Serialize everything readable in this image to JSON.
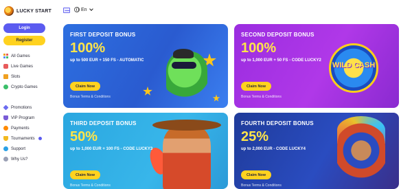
{
  "brand": {
    "name": "LUCKY START"
  },
  "header": {
    "language": "En"
  },
  "sidebar": {
    "login_label": "Login",
    "register_label": "Register",
    "games": [
      {
        "label": "All Games",
        "icon": "grid-icon"
      },
      {
        "label": "Live Games",
        "icon": "live-icon"
      },
      {
        "label": "Slots",
        "icon": "slots-icon"
      },
      {
        "label": "Crypto Games",
        "icon": "crypto-icon"
      }
    ],
    "menu": [
      {
        "label": "Promotions",
        "icon": "promotions-icon"
      },
      {
        "label": "VIP Program",
        "icon": "vip-icon"
      },
      {
        "label": "Payments",
        "icon": "payments-icon"
      },
      {
        "label": "Tournaments",
        "icon": "trophy-icon"
      },
      {
        "label": "Support",
        "icon": "support-icon"
      },
      {
        "label": "Why Us?",
        "icon": "info-icon"
      }
    ]
  },
  "bonuses": [
    {
      "title": "FIRST DEPOSIT BONUS",
      "percent": "100%",
      "description": "up to 500 EUR + 150 FS - AUTOMATIC",
      "claim_label": "Claim Now",
      "terms_label": "Bonus Terms & Conditions"
    },
    {
      "title": "SECOND DEPOSIT BONUS",
      "percent": "100%",
      "description": "up to 1,000 EUR + 50 FS - CODE LUCKY2",
      "claim_label": "Claim Now",
      "terms_label": "Bonus Terms & Conditions",
      "art_text": "WILD CASH"
    },
    {
      "title": "THIRD DEPOSIT BONUS",
      "percent": "50%",
      "description": "up to 1,000 EUR + 100 FS - CODE LUCKY3",
      "claim_label": "Claim Now",
      "terms_label": "Bonus Terms & Conditions"
    },
    {
      "title": "FOURTH DEPOSIT BONUS",
      "percent": "25%",
      "description": "up to 2,000 EUR - CODE LUCKY4",
      "claim_label": "Claim Now",
      "terms_label": "Bonus Terms & Conditions"
    }
  ],
  "colors": {
    "accent": "#5b5bf0",
    "cta": "#ffd21f",
    "card1": "#2a5bd0",
    "card2": "#b038e8",
    "card3": "#38b6ea",
    "card4": "#2a4cc0"
  }
}
